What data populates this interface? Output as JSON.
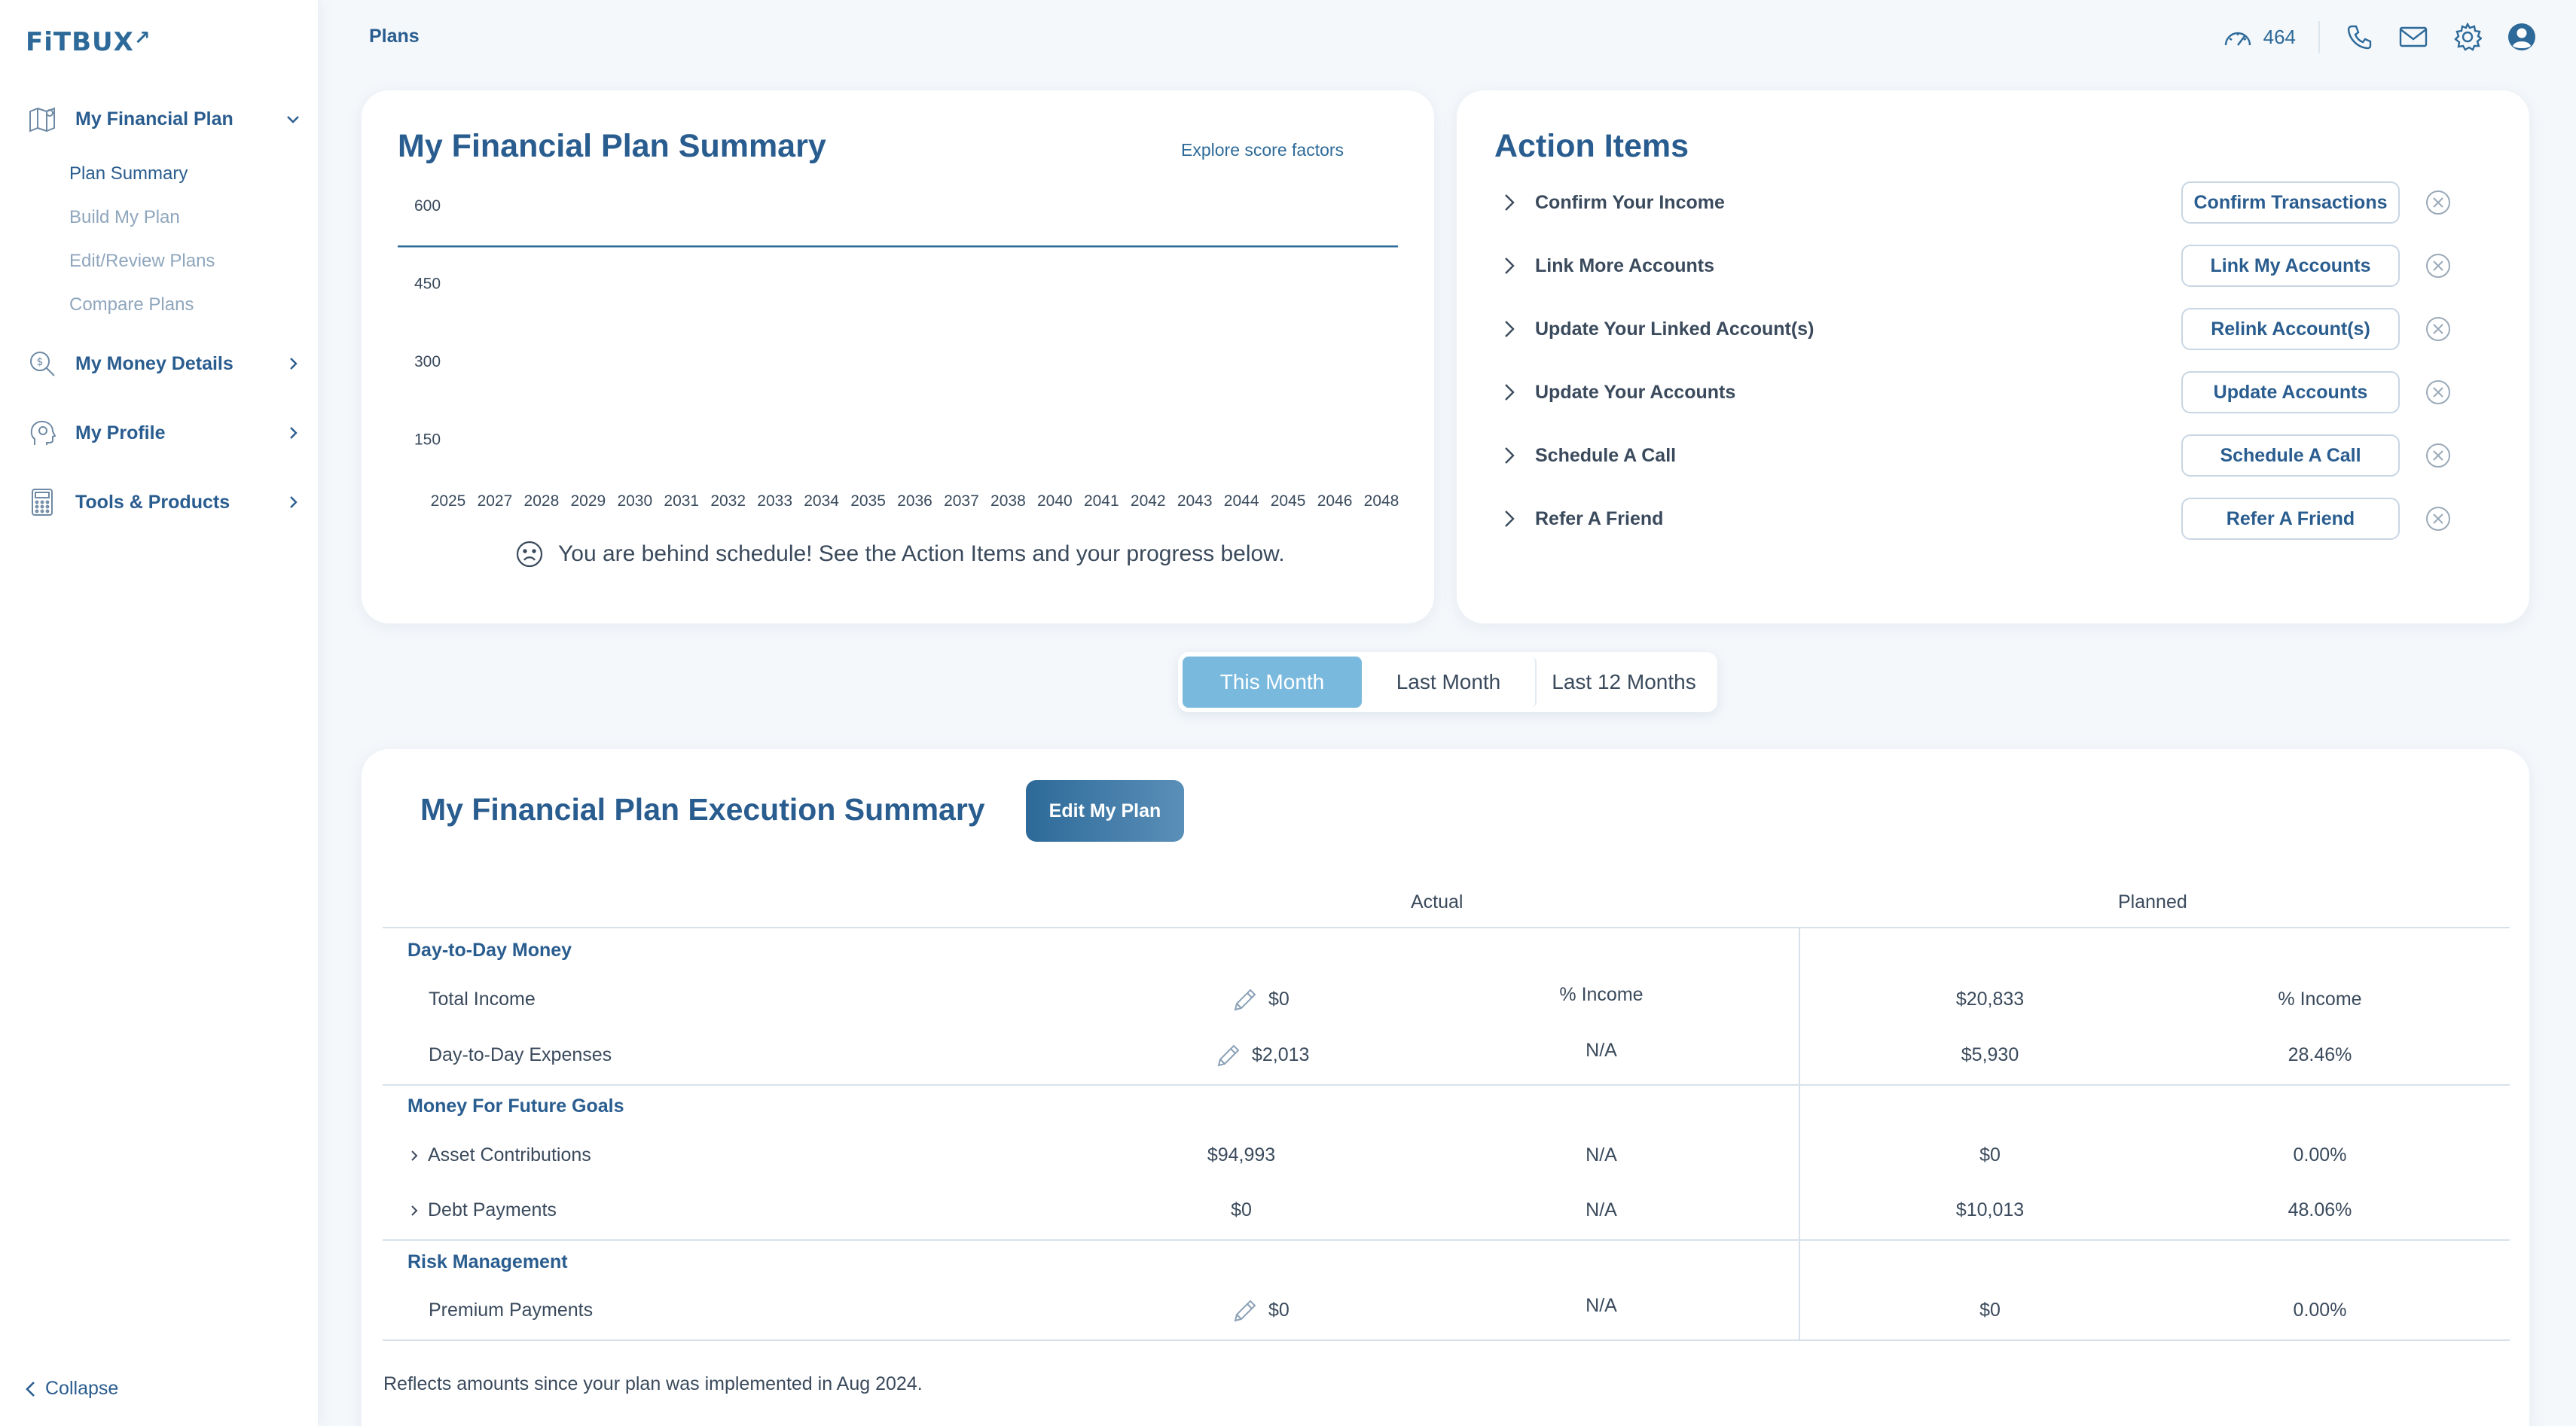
{
  "brand": {
    "logo_text": "FiTBUX",
    "logo_arrow": "↗"
  },
  "sidebar": {
    "groups": [
      {
        "label": "My Financial Plan",
        "icon": "map-icon",
        "expanded": true
      },
      {
        "label": "My Money Details",
        "icon": "money-search-icon",
        "expanded": false
      },
      {
        "label": "My Profile",
        "icon": "head-icon",
        "expanded": false
      },
      {
        "label": "Tools & Products",
        "icon": "calculator-icon",
        "expanded": false
      }
    ],
    "sub_items": [
      "Plan Summary",
      "Build My Plan",
      "Edit/Review Plans",
      "Compare Plans"
    ],
    "active_sub_item": "Plan Summary",
    "collapse_label": "Collapse"
  },
  "header": {
    "breadcrumb": "Plans",
    "score": "464",
    "icons": [
      "gauge-icon",
      "phone-icon",
      "mail-icon",
      "gear-icon",
      "user-icon"
    ]
  },
  "summary_card": {
    "title": "My Financial Plan Summary",
    "explore_link": "Explore score factors",
    "status_message": "You are behind schedule! See the Action Items and your progress below."
  },
  "chart_data": {
    "type": "line",
    "title": "",
    "x": [
      "2025",
      "2027",
      "2028",
      "2029",
      "2030",
      "2031",
      "2032",
      "2033",
      "2034",
      "2035",
      "2036",
      "2037",
      "2038",
      "2040",
      "2041",
      "2042",
      "2043",
      "2044",
      "2045",
      "2046",
      "2048"
    ],
    "y_ticks": [
      "600",
      "450",
      "300",
      "150"
    ],
    "ylim": [
      0,
      600
    ],
    "series": [
      {
        "values": [
          520,
          520,
          520,
          520,
          520,
          520,
          520,
          520,
          520,
          520,
          520,
          520,
          520,
          520,
          520,
          520,
          520,
          520,
          520,
          520,
          520
        ]
      }
    ],
    "grid": false,
    "legend": "none",
    "line_color": "#2d6a99"
  },
  "action_items": {
    "title": "Action Items",
    "items": [
      {
        "label": "Confirm Your Income",
        "button": "Confirm Transactions"
      },
      {
        "label": "Link More Accounts",
        "button": "Link My Accounts"
      },
      {
        "label": "Update Your Linked Account(s)",
        "button": "Relink Account(s)"
      },
      {
        "label": "Update Your Accounts",
        "button": "Update Accounts"
      },
      {
        "label": "Schedule A Call",
        "button": "Schedule A Call"
      },
      {
        "label": "Refer A Friend",
        "button": "Refer A Friend"
      }
    ]
  },
  "period_tabs": {
    "options": [
      "This Month",
      "Last Month",
      "Last 12 Months"
    ],
    "selected": "This Month"
  },
  "execution": {
    "title": "My Financial Plan Execution Summary",
    "edit_button": "Edit My Plan",
    "columns": {
      "actual": "Actual",
      "planned": "Planned"
    },
    "sections": [
      {
        "label": "Day-to-Day Money",
        "rows": [
          {
            "label": "Total Income",
            "actual": "$0",
            "actual_pct": "% Income",
            "planned": "$20,833",
            "planned_pct": "% Income",
            "editable": true,
            "expandable": false
          },
          {
            "label": "Day-to-Day Expenses",
            "actual": "$2,013",
            "actual_pct": "N/A",
            "planned": "$5,930",
            "planned_pct": "28.46%",
            "editable": true,
            "expandable": false
          }
        ]
      },
      {
        "label": "Money For Future Goals",
        "rows": [
          {
            "label": "Asset Contributions",
            "actual": "$94,993",
            "actual_pct": "N/A",
            "planned": "$0",
            "planned_pct": "0.00%",
            "editable": false,
            "expandable": true
          },
          {
            "label": "Debt Payments",
            "actual": "$0",
            "actual_pct": "N/A",
            "planned": "$10,013",
            "planned_pct": "48.06%",
            "editable": false,
            "expandable": true
          }
        ]
      },
      {
        "label": "Risk Management",
        "rows": [
          {
            "label": "Premium Payments",
            "actual": "$0",
            "actual_pct": "N/A",
            "planned": "$0",
            "planned_pct": "0.00%",
            "editable": true,
            "expandable": false
          }
        ]
      }
    ],
    "footnote": "Reflects amounts since your plan was implemented in Aug 2024."
  },
  "colors": {
    "brand": "#2a5d8f",
    "accent": "#7ab9de",
    "text": "#3a4a5c",
    "muted": "#8fa6bd"
  }
}
